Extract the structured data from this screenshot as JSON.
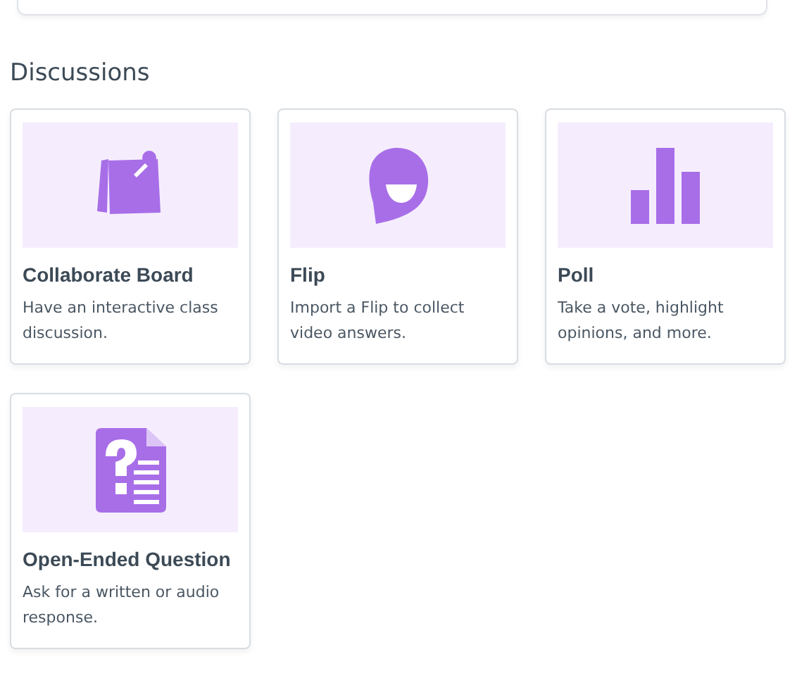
{
  "section": {
    "title": "Discussions"
  },
  "cards": [
    {
      "kind": "board",
      "title": "Collaborate Board",
      "description": "Have an interactive class discussion."
    },
    {
      "kind": "flip",
      "title": "Flip",
      "description": "Import a Flip to collect video answers."
    },
    {
      "kind": "poll",
      "title": "Poll",
      "description": "Take a vote, highlight opinions, and more."
    },
    {
      "kind": "question",
      "title": "Open-Ended Question",
      "description": "Ask for a written or audio response."
    }
  ]
}
